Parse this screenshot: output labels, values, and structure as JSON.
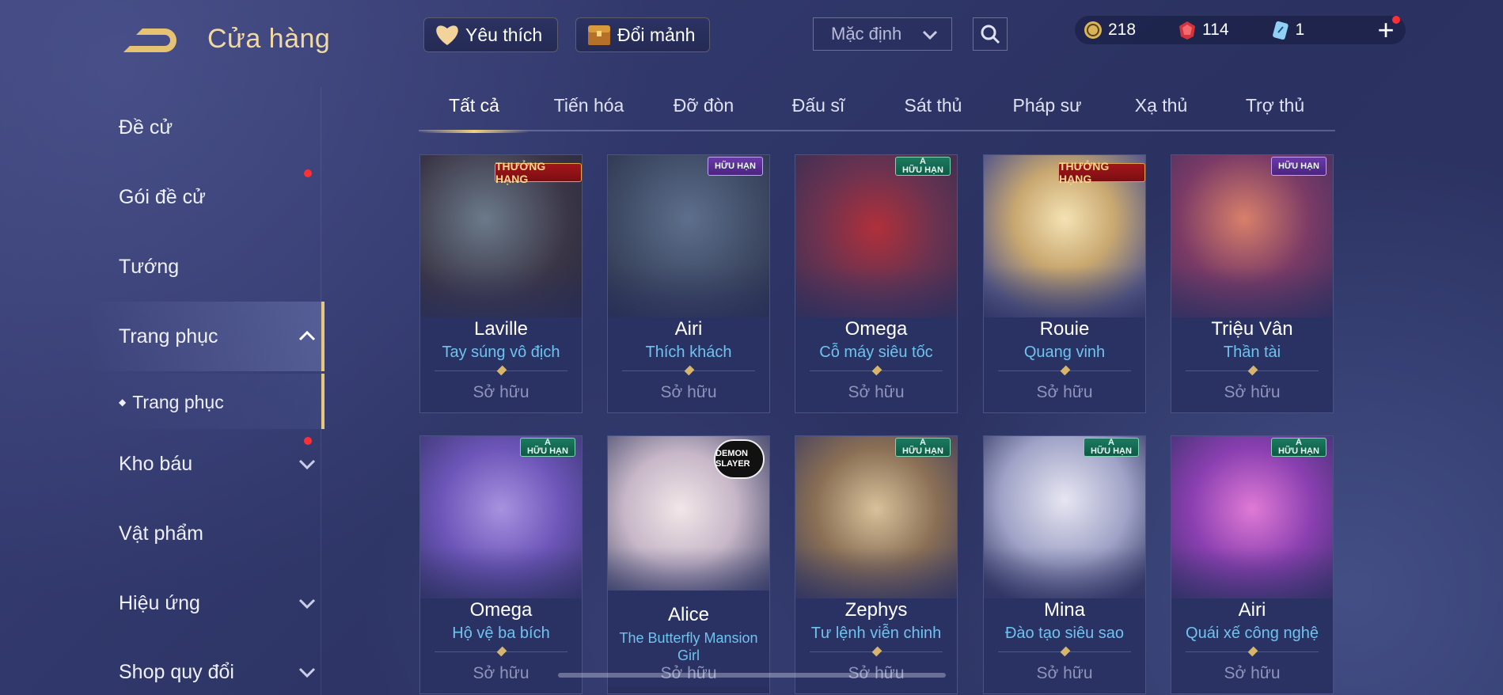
{
  "header": {
    "title": "Cửa hàng",
    "favorites_label": "Yêu thích",
    "exchange_label": "Đổi mảnh",
    "sort": {
      "value": "Mặc định"
    },
    "currencies": [
      {
        "icon": "gold-coin-icon",
        "value": "218"
      },
      {
        "icon": "red-gem-icon",
        "value": "114"
      },
      {
        "icon": "ticket-icon",
        "value": "1"
      }
    ]
  },
  "sidebar": {
    "items": [
      {
        "label": "Đề cử"
      },
      {
        "label": "Gói đề cử"
      },
      {
        "label": "Tướng"
      },
      {
        "label": "Trang phục"
      },
      {
        "label": "Trang phục"
      },
      {
        "label": "Kho báu"
      },
      {
        "label": "Vật phẩm"
      },
      {
        "label": "Hiệu ứng"
      },
      {
        "label": "Shop quy đổi"
      }
    ]
  },
  "tabs": [
    {
      "label": "Tất cả"
    },
    {
      "label": "Tiến hóa"
    },
    {
      "label": "Đỡ đòn"
    },
    {
      "label": "Đấu sĩ"
    },
    {
      "label": "Sát thủ"
    },
    {
      "label": "Pháp sư"
    },
    {
      "label": "Xạ thủ"
    },
    {
      "label": "Trợ thủ"
    }
  ],
  "cards": [
    {
      "hero": "Laville",
      "skin": "Tay súng vô địch",
      "status": "Sở hữu",
      "badge": "THƯỞNG HẠNG"
    },
    {
      "hero": "Airi",
      "skin": "Thích khách",
      "status": "Sở hữu",
      "badge": "HỮU HẠN"
    },
    {
      "hero": "Omega",
      "skin": "Cỗ máy siêu tốc",
      "status": "Sở hữu",
      "badge_tier": "A",
      "badge": "HỮU HẠN"
    },
    {
      "hero": "Rouie",
      "skin": "Quang vinh",
      "status": "Sở hữu",
      "badge": "THƯỞNG HẠNG"
    },
    {
      "hero": "Triệu Vân",
      "skin": "Thần tài",
      "status": "Sở hữu",
      "badge": "HỮU HẠN"
    },
    {
      "hero": "Omega",
      "skin": "Hộ vệ ba bích",
      "status": "Sở hữu",
      "badge_tier": "A",
      "badge": "HỮU HẠN"
    },
    {
      "hero": "Alice",
      "skin": "The Butterfly Mansion Girl",
      "status": "Sở hữu",
      "badge": "DEMON SLAYER"
    },
    {
      "hero": "Zephys",
      "skin": "Tư lệnh viễn chinh",
      "status": "Sở hữu",
      "badge_tier": "A",
      "badge": "HỮU HẠN"
    },
    {
      "hero": "Mina",
      "skin": "Đào tạo siêu sao",
      "status": "Sở hữu",
      "badge_tier": "A",
      "badge": "HỮU HẠN"
    },
    {
      "hero": "Airi",
      "skin": "Quái xế công nghệ",
      "status": "Sở hữu",
      "badge_tier": "A",
      "badge": "HỮU HẠN"
    }
  ],
  "colors": {
    "accent_gold": "#e6c77c",
    "skin_blue": "#6ec3ef",
    "notice_red": "#ff2f36"
  }
}
